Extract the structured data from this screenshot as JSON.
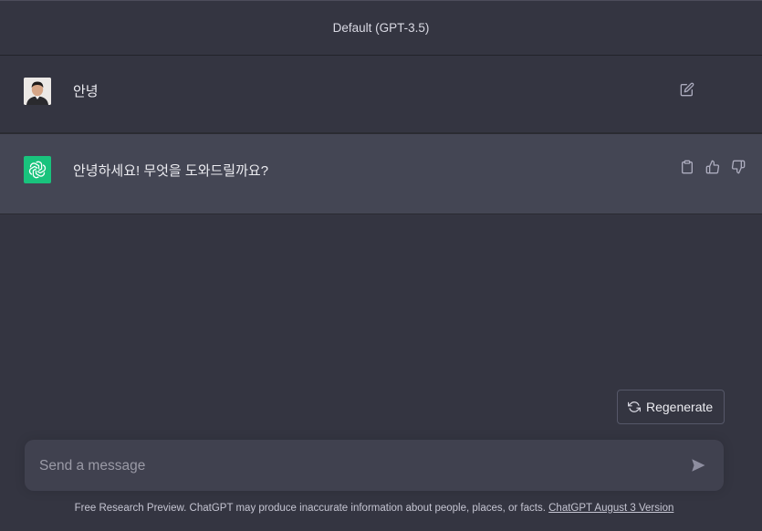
{
  "header": {
    "model_label": "Default (GPT-3.5)"
  },
  "conversation": [
    {
      "role": "user",
      "text": "안녕",
      "actions": [
        "edit-icon"
      ]
    },
    {
      "role": "assistant",
      "text": "안녕하세요! 무엇을 도와드릴까요?",
      "actions": [
        "clipboard-icon",
        "thumbs-up-icon",
        "thumbs-down-icon"
      ]
    }
  ],
  "regenerate": {
    "label": "Regenerate",
    "icon": "refresh-icon"
  },
  "composer": {
    "placeholder": "Send a message",
    "value": "",
    "send_icon": "send-icon"
  },
  "footer": {
    "text": "Free Research Preview. ChatGPT may produce inaccurate information about people, places, or facts.",
    "link_text": "ChatGPT August 3 Version"
  },
  "colors": {
    "background": "#343541",
    "assistant_row": "#444654",
    "input_bg": "#40414f",
    "openai_green": "#19c37d"
  }
}
